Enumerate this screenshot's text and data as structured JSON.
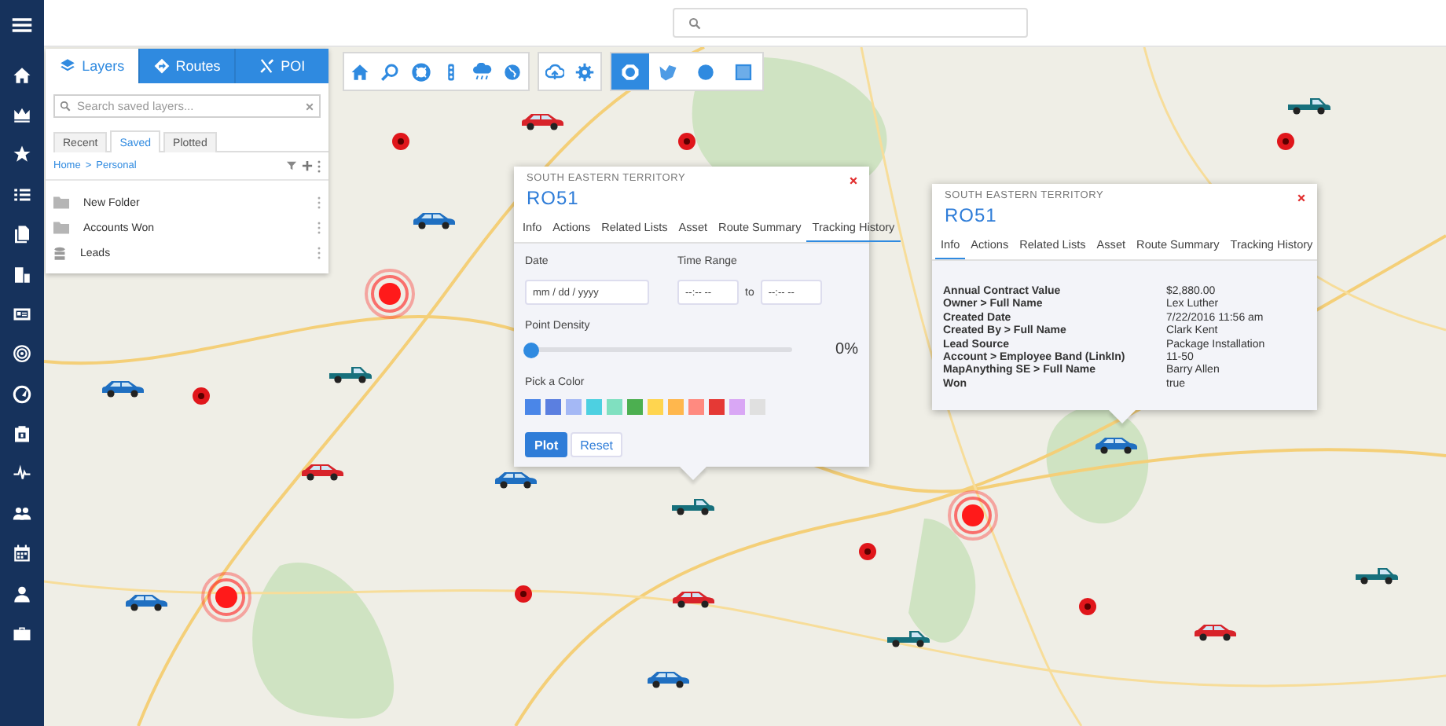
{
  "layers_panel": {
    "tabs": [
      {
        "label": "Layers",
        "selected": true
      },
      {
        "label": "Routes",
        "selected": false
      },
      {
        "label": "POI",
        "selected": false
      }
    ],
    "search": {
      "placeholder": "Search saved layers..."
    },
    "subtabs": [
      {
        "label": "Recent",
        "selected": false
      },
      {
        "label": "Saved",
        "selected": true
      },
      {
        "label": "Plotted",
        "selected": false
      }
    ],
    "breadcrumb": {
      "home": "Home",
      "separator": ">",
      "current": "Personal"
    },
    "items": [
      {
        "label": "New Folder",
        "kind": "folder"
      },
      {
        "label": "Accounts Won",
        "kind": "folder"
      },
      {
        "label": "Leads",
        "kind": "layer"
      }
    ]
  },
  "toolbar": {
    "draw_tools": [
      {
        "selected": true
      },
      {
        "selected": false
      },
      {
        "selected": false
      },
      {
        "selected": false
      }
    ]
  },
  "tracking_popup": {
    "subtitle": "SOUTH EASTERN TERRITORY",
    "title": "RO51",
    "tabs": [
      {
        "label": "Info",
        "selected": false
      },
      {
        "label": "Actions",
        "selected": false
      },
      {
        "label": "Related Lists",
        "selected": false
      },
      {
        "label": "Asset",
        "selected": false
      },
      {
        "label": "Route Summary",
        "selected": false
      },
      {
        "label": "Tracking History",
        "selected": true
      }
    ],
    "date": {
      "label": "Date",
      "placeholder": "mm / dd / yyyy"
    },
    "time_range": {
      "label": "Time Range",
      "from_placeholder": "--:-- --",
      "joiner": "to",
      "to_placeholder": "--:-- --"
    },
    "point_density": {
      "label": "Point Density",
      "level": 0,
      "reading": "0%"
    },
    "color_picker": {
      "label": "Pick a Color",
      "swatches": [
        {
          "color": "#4a86e8",
          "selected": false
        },
        {
          "color": "#5b7fe0",
          "selected": false
        },
        {
          "color": "#a4b8f5",
          "selected": false
        },
        {
          "color": "#4dd0e1",
          "selected": false
        },
        {
          "color": "#80e0c0",
          "selected": false
        },
        {
          "color": "#4caf50",
          "selected": false
        },
        {
          "color": "#ffd54f",
          "selected": false
        },
        {
          "color": "#ffb74d",
          "selected": false
        },
        {
          "color": "#ff8a80",
          "selected": false
        },
        {
          "color": "#e53935",
          "selected": false
        },
        {
          "color": "#d9a7f5",
          "selected": false
        },
        {
          "color": "#e0e0e0",
          "selected": false
        }
      ]
    },
    "buttons": [
      {
        "label": "Plot",
        "kind": "primary"
      },
      {
        "label": "Reset",
        "kind": "secondary"
      }
    ]
  },
  "info_popup": {
    "subtitle": "SOUTH EASTERN TERRITORY",
    "title": "RO51",
    "tabs": [
      {
        "label": "Info",
        "selected": true
      },
      {
        "label": "Actions",
        "selected": false
      },
      {
        "label": "Related Lists",
        "selected": false
      },
      {
        "label": "Asset",
        "selected": false
      },
      {
        "label": "Route Summary",
        "selected": false
      },
      {
        "label": "Tracking History",
        "selected": false
      }
    ],
    "fields": [
      {
        "label": "Annual Contract Value",
        "value": "$2,880.00"
      },
      {
        "label": "Owner > Full Name",
        "value": "Lex Luther"
      },
      {
        "label": "Created Date",
        "value": "7/22/2016 11:56 am"
      },
      {
        "label": "Created By > Full Name",
        "value": "Clark Kent"
      },
      {
        "label": "Lead Source",
        "value": "Package Installation"
      },
      {
        "label": "Account > Employee Band (LinkIn)",
        "value": "11-50"
      },
      {
        "label": "MapAnything SE > Full Name",
        "value": "Barry Allen"
      },
      {
        "label": "Won",
        "value": "true"
      }
    ]
  },
  "map": {
    "markers": [
      {
        "kind": "car",
        "color": "#d8232a"
      },
      {
        "kind": "pickup",
        "color": "#17707c"
      },
      {
        "kind": "car",
        "color": "#1f6fc1"
      },
      {
        "kind": "pickup",
        "color": "#17707c"
      },
      {
        "kind": "car",
        "color": "#1f6fc1"
      },
      {
        "kind": "car",
        "color": "#d8232a"
      },
      {
        "kind": "car",
        "color": "#1f6fc1"
      },
      {
        "kind": "pickup",
        "color": "#17707c"
      },
      {
        "kind": "car",
        "color": "#1f6fc1"
      },
      {
        "kind": "car",
        "color": "#d8232a"
      },
      {
        "kind": "pickup",
        "color": "#17707c"
      },
      {
        "kind": "pickup",
        "color": "#17707c"
      },
      {
        "kind": "car",
        "color": "#1f6fc1"
      },
      {
        "kind": "car",
        "color": "#d8232a"
      },
      {
        "kind": "car",
        "color": "#1f6fc1"
      },
      {
        "kind": "pin",
        "color": "#e0161b"
      },
      {
        "kind": "pin",
        "color": "#e0161b"
      },
      {
        "kind": "pin",
        "color": "#e0161b"
      },
      {
        "kind": "pin",
        "color": "#e0161b"
      },
      {
        "kind": "pin",
        "color": "#e0161b"
      },
      {
        "kind": "pin",
        "color": "#e0161b"
      },
      {
        "kind": "pin",
        "color": "#e0161b"
      },
      {
        "kind": "pulse",
        "color": "#ff1a1a"
      },
      {
        "kind": "pulse",
        "color": "#ff1a1a"
      },
      {
        "kind": "pulse",
        "color": "#ff1a1a"
      }
    ]
  }
}
